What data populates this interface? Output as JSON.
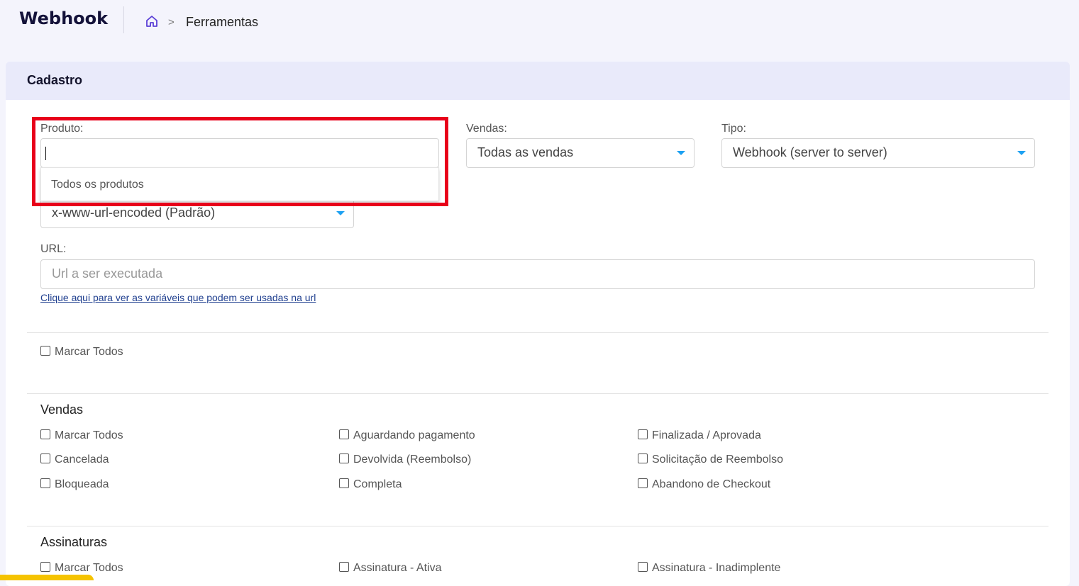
{
  "app_title": "Webhook",
  "breadcrumb": {
    "separator": ">",
    "current": "Ferramentas"
  },
  "card": {
    "title": "Cadastro"
  },
  "form": {
    "produto": {
      "label": "Produto:",
      "value": "",
      "dropdown_option": "Todos os produtos"
    },
    "vendas": {
      "label": "Vendas:",
      "value": "Todas as vendas"
    },
    "tipo": {
      "label": "Tipo:",
      "value": "Webhook (server to server)"
    },
    "formato": {
      "value": "x-www-url-encoded (Padrão)"
    },
    "url": {
      "label": "URL:",
      "placeholder": "Url a ser executada",
      "help_link": "Clique aqui para ver as variáveis que podem ser usadas na url"
    }
  },
  "marcar_todos_global": "Marcar Todos",
  "sections": {
    "vendas": {
      "title": "Vendas",
      "items": [
        "Marcar Todos",
        "Aguardando pagamento",
        "Finalizada / Aprovada",
        "Cancelada",
        "Devolvida (Reembolso)",
        "Solicitação de Reembolso",
        "Bloqueada",
        "Completa",
        "Abandono de Checkout"
      ]
    },
    "assinaturas": {
      "title": "Assinaturas",
      "items": [
        "Marcar Todos",
        "Assinatura - Ativa",
        "Assinatura - Inadimplente"
      ]
    }
  },
  "colors": {
    "accent": "#1da1f2",
    "highlight": "#e8001a",
    "header_bg": "#e9eafa"
  }
}
